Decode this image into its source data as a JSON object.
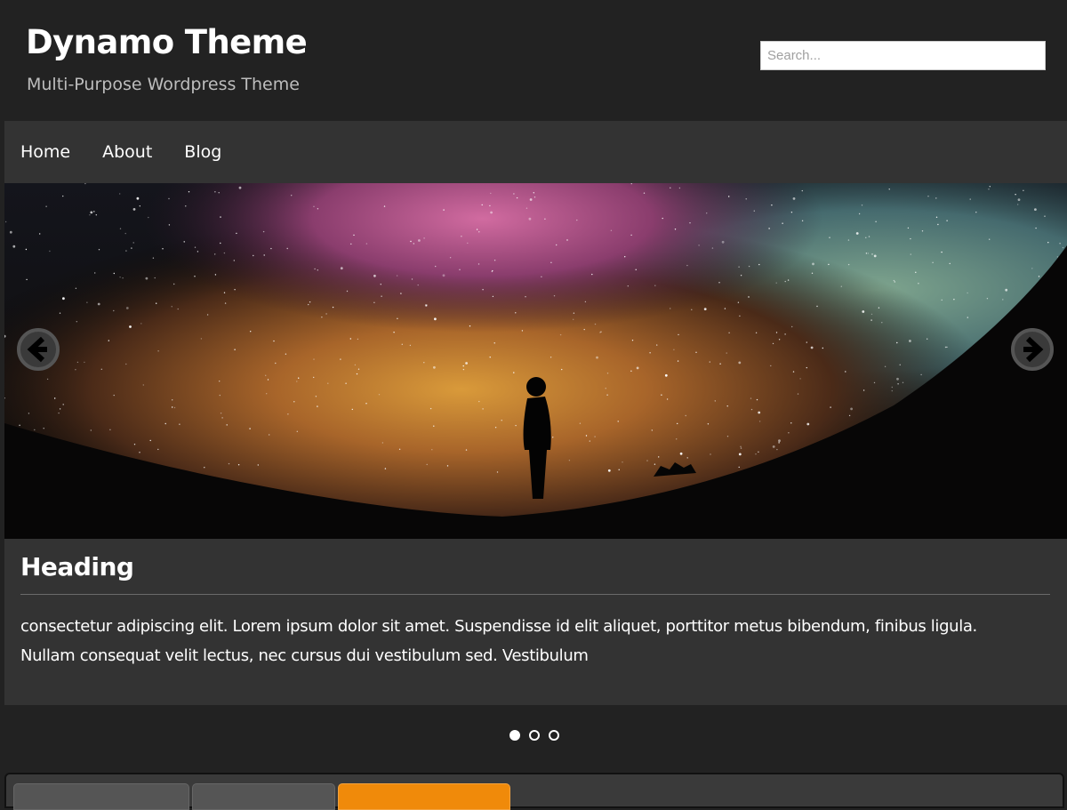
{
  "header": {
    "site_title": "Dynamo Theme",
    "tagline": "Multi-Purpose Wordpress Theme",
    "search_placeholder": "Search..."
  },
  "nav": {
    "items": [
      {
        "label": "Home"
      },
      {
        "label": "About"
      },
      {
        "label": "Blog"
      }
    ]
  },
  "slider": {
    "image_subject": "silhouette of a person under a starry milky way night sky",
    "heading": "Heading",
    "text": "consectetur adipiscing elit. Lorem ipsum dolor sit amet. Suspendisse id elit aliquet, porttitor metus bibendum, finibus ligula. Nullam consequat velit lectus, nec cursus dui vestibulum sed. Vestibulum",
    "prev_icon": "arrow-left-circle-icon",
    "next_icon": "arrow-right-circle-icon",
    "slide_count": 3,
    "active_slide": 1
  },
  "tabs": {
    "active_index": 2,
    "active_color": "#f08a0a"
  },
  "colors": {
    "page_background": "#222222",
    "panel_background": "#333333",
    "text": "#ffffff",
    "tagline": "#bdbdbd"
  }
}
